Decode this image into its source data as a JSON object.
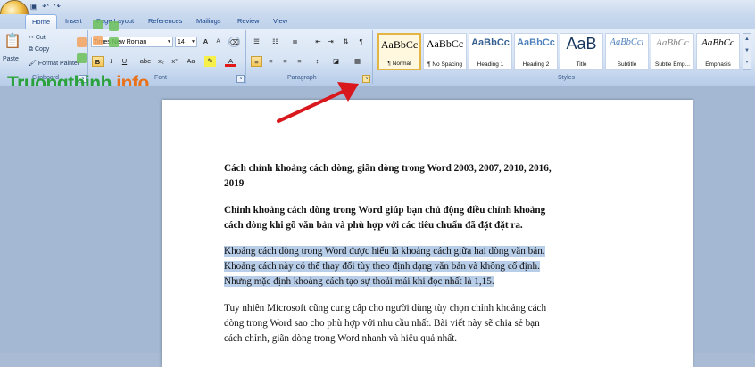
{
  "quick_access": {
    "icons": [
      "save-icon",
      "undo-icon",
      "redo-icon"
    ]
  },
  "tabs": [
    "Home",
    "Insert",
    "Page Layout",
    "References",
    "Mailings",
    "Review",
    "View"
  ],
  "clipboard": {
    "paste_label": "Paste",
    "cut_label": "Cut",
    "copy_label": "Copy",
    "format_painter_label": "Format Painter",
    "group_label": "Clipboard"
  },
  "font": {
    "name": "Times New Roman",
    "size": "14",
    "group_label": "Font",
    "grow": "A",
    "shrink": "A",
    "bold": "B",
    "italic": "I",
    "underline": "U",
    "strike": "abe",
    "subscript": "x₂",
    "superscript": "x²",
    "change_case": "Aa",
    "font_color": "A"
  },
  "paragraph": {
    "group_label": "Paragraph",
    "pilcrow": "¶"
  },
  "styles": {
    "group_label": "Styles",
    "items": [
      {
        "sample": "AaBbCc",
        "name": "¶ Normal"
      },
      {
        "sample": "AaBbCc",
        "name": "¶ No Spacing"
      },
      {
        "sample": "AaBbCc",
        "name": "Heading 1"
      },
      {
        "sample": "AaBbCc",
        "name": "Heading 2"
      },
      {
        "sample": "AaB",
        "name": "Title"
      },
      {
        "sample": "AaBbCci",
        "name": "Subtitle"
      },
      {
        "sample": "AaBbCc",
        "name": "Subtle Emp..."
      },
      {
        "sample": "AaBbCc",
        "name": "Emphasis"
      }
    ]
  },
  "watermark": {
    "part1": "Truongthinh",
    "part2": ".info"
  },
  "document": {
    "title_line1": "Cách chỉnh khoảng cách dòng, giãn dòng trong Word 2003, 2007, 2010, 2016,",
    "title_line2": "2019",
    "intro_line1": "Chỉnh khoảng cách dòng trong Word giúp bạn chủ động điều chỉnh khoảng",
    "intro_line2": "cách dòng khi gõ văn bản và phù hợp với các tiêu chuẩn đã đặt đặt ra.",
    "selected_line1": "Khoảng cách dòng trong Word được hiểu là khoảng cách giữa hai dòng văn bản.",
    "selected_line2": "Khoảng cách này có thể thay đổi tùy theo định dạng văn bản và không cố định.",
    "selected_line3": "Nhưng mặc định khoảng cách tạo sự thoải mái khi đọc nhất là 1,15.",
    "body_line1": "Tuy nhiên Microsoft cũng cung cấp cho người dùng tùy chọn chỉnh khoảng cách",
    "body_line2": "dòng trong Word sao cho phù hợp với nhu cầu nhất. Bài viết này sẽ chia sẻ bạn",
    "body_line3": "cách chỉnh, giãn dòng trong Word nhanh và hiệu quả nhất."
  },
  "colors": {
    "arrow": "#d8181c",
    "selection": "#b8cde8",
    "ribbon": "#d7e4f4"
  }
}
